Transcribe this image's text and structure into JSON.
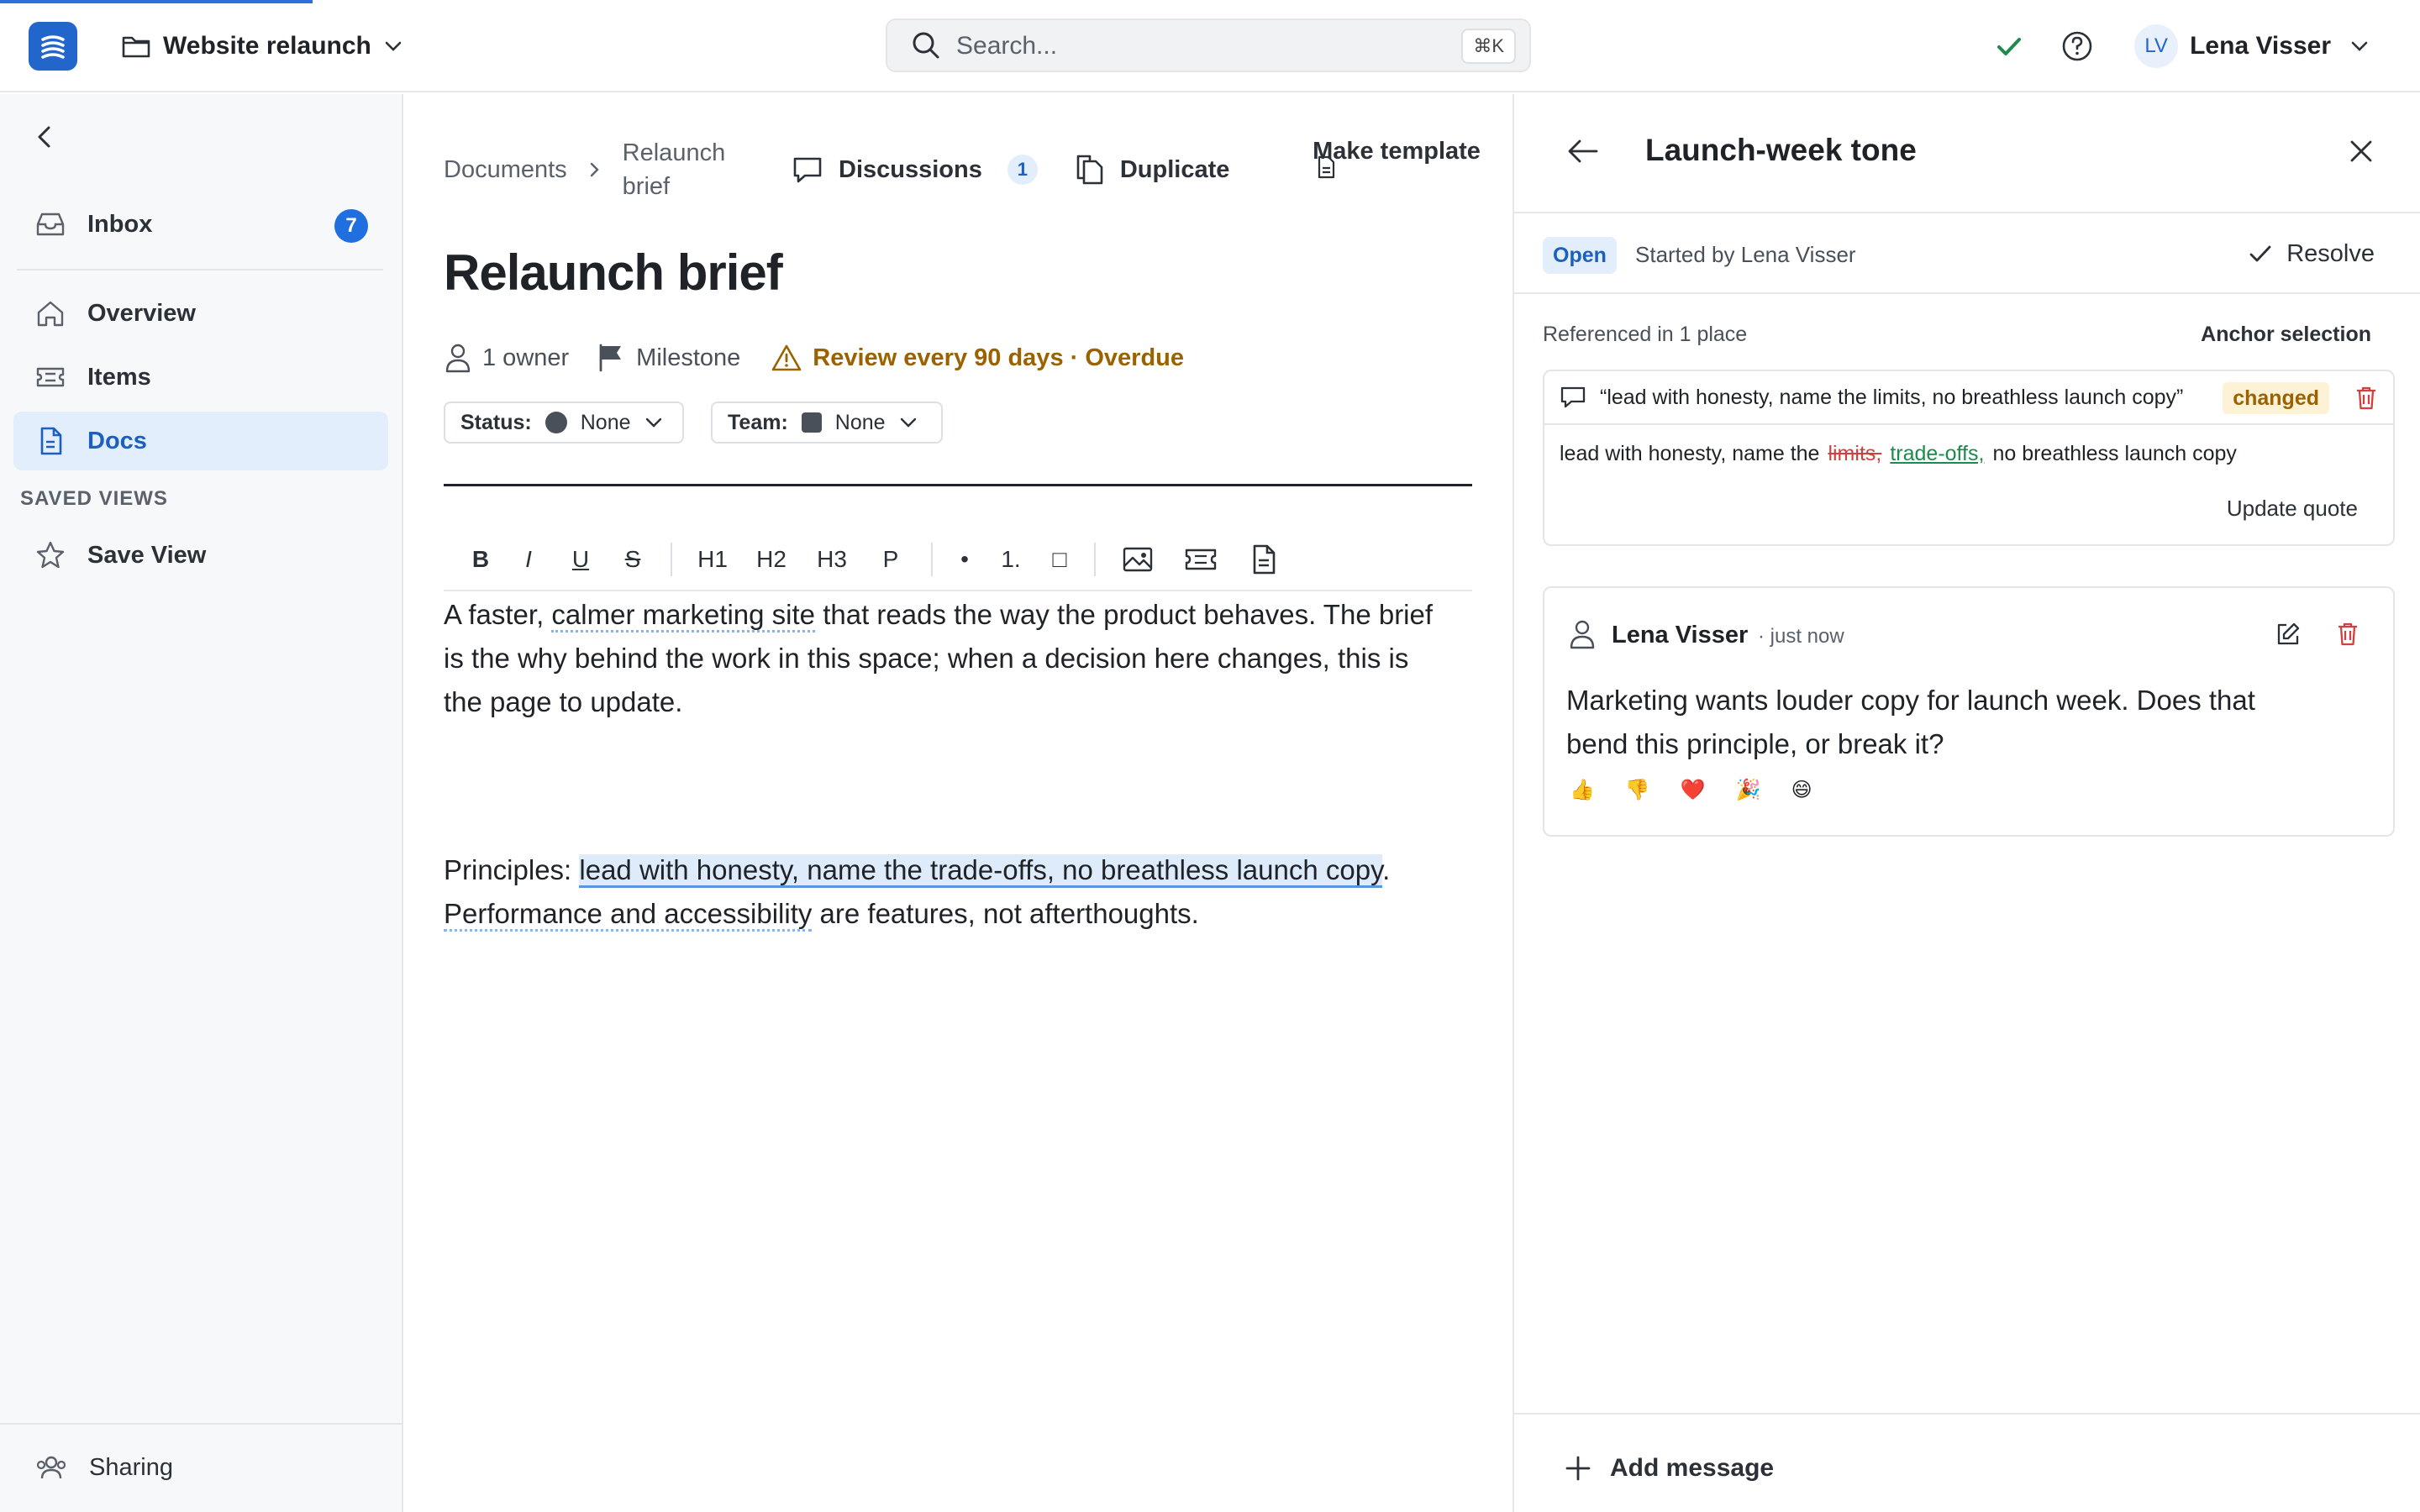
{
  "app": {
    "project_name": "Website relaunch",
    "search_placeholder": "Search...",
    "search_shortcut": "⌘K",
    "user_initials": "LV",
    "user_name": "Lena Visser"
  },
  "sidebar": {
    "items": [
      {
        "label": "Inbox",
        "badge": "7",
        "icon": "inbox-icon"
      },
      {
        "label": "Overview",
        "icon": "home-icon"
      },
      {
        "label": "Items",
        "icon": "ticket-icon"
      },
      {
        "label": "Docs",
        "icon": "document-icon",
        "active": true
      }
    ],
    "saved_views_title": "SAVED VIEWS",
    "save_view_label": "Save View",
    "sharing_label": "Sharing"
  },
  "doc": {
    "breadcrumb_root": "Documents",
    "breadcrumb_current": "Relaunch brief",
    "discussions_label": "Discussions",
    "discussions_count": "1",
    "duplicate_label": "Duplicate",
    "make_template_label": "Make template",
    "title": "Relaunch brief",
    "owners": "1 owner",
    "milestone": "Milestone",
    "review": "Review every 90 days · Overdue",
    "status_label": "Status:",
    "status_value": "None",
    "team_label": "Team:",
    "team_value": "None",
    "toolbar": [
      "B",
      "I",
      "U",
      "S",
      "H1",
      "H2",
      "H3",
      "P",
      "•",
      "1.",
      "□"
    ],
    "p1": {
      "before": "A faster, ",
      "link": "calmer marketing site",
      "after": " that reads the way the product behaves. The brief is the why behind the work in this space; when a decision here changes, this is the page to update."
    },
    "p2": {
      "before": "Principles: ",
      "highlight": "lead with honesty, name the trade-offs, no breathless launch copy",
      "middle": ". ",
      "link": "Performance and accessibility",
      "after": " are features, not afterthoughts."
    }
  },
  "panel": {
    "title": "Launch-week tone",
    "status": "Open",
    "started_by": "Started by Lena Visser",
    "resolve_label": "Resolve",
    "referenced": "Referenced in 1 place",
    "anchor_selection": "Anchor selection",
    "quote": "“lead with honesty, name the limits, no breathless launch copy”",
    "changed_label": "changed",
    "diff_before": "lead with honesty, name the",
    "diff_removed": "limits,",
    "diff_added": "trade-offs,",
    "diff_after": "no breathless launch copy",
    "update_quote": "Update quote",
    "message": {
      "author": "Lena Visser",
      "time": "· just now",
      "body": "Marketing wants louder copy for launch week. Does that bend this principle, or break it?",
      "reactions": [
        "👍",
        "👎",
        "❤️",
        "🎉",
        "😄"
      ]
    },
    "add_message": "Add message"
  },
  "colors": {
    "accent": "#2266cc",
    "active_bg": "#e3eefc",
    "warning": "#9a6200",
    "danger": "#d13f3f",
    "success": "#1e8a4c"
  }
}
